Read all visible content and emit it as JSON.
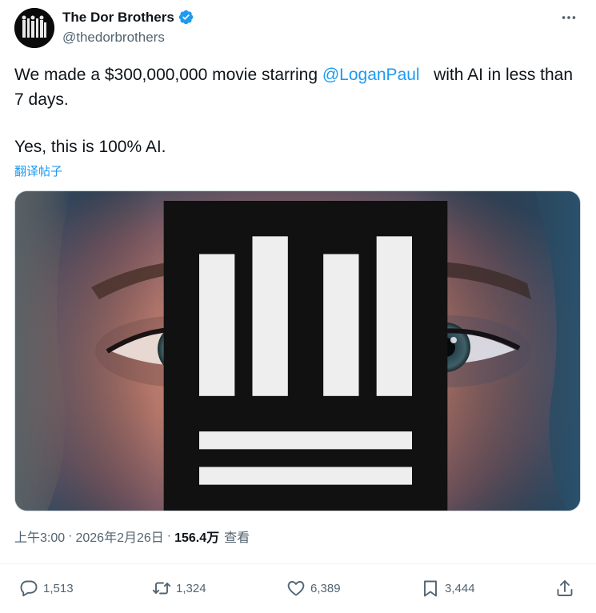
{
  "author": {
    "display_name": "The Dor Brothers",
    "handle": "@thedorbrothers",
    "verified": true
  },
  "tweet": {
    "text_before_mention": "We made a $300,000,000 movie starring ",
    "mention": "@LoganPaul",
    "text_after_mention": "   with AI in less than 7 days.",
    "second_paragraph": "Yes, this is 100% AI.",
    "translate_label": "翻译帖子"
  },
  "meta": {
    "time": "上午3:00",
    "separator": "·",
    "date": "2026年2月26日",
    "views_count": "156.4万",
    "views_label": "查看"
  },
  "actions": {
    "replies": "1,513",
    "retweets": "1,324",
    "likes": "6,389",
    "bookmarks": "3,444"
  },
  "colors": {
    "accent": "#1d9bf0",
    "text_primary": "#0f1419",
    "text_secondary": "#536471"
  }
}
